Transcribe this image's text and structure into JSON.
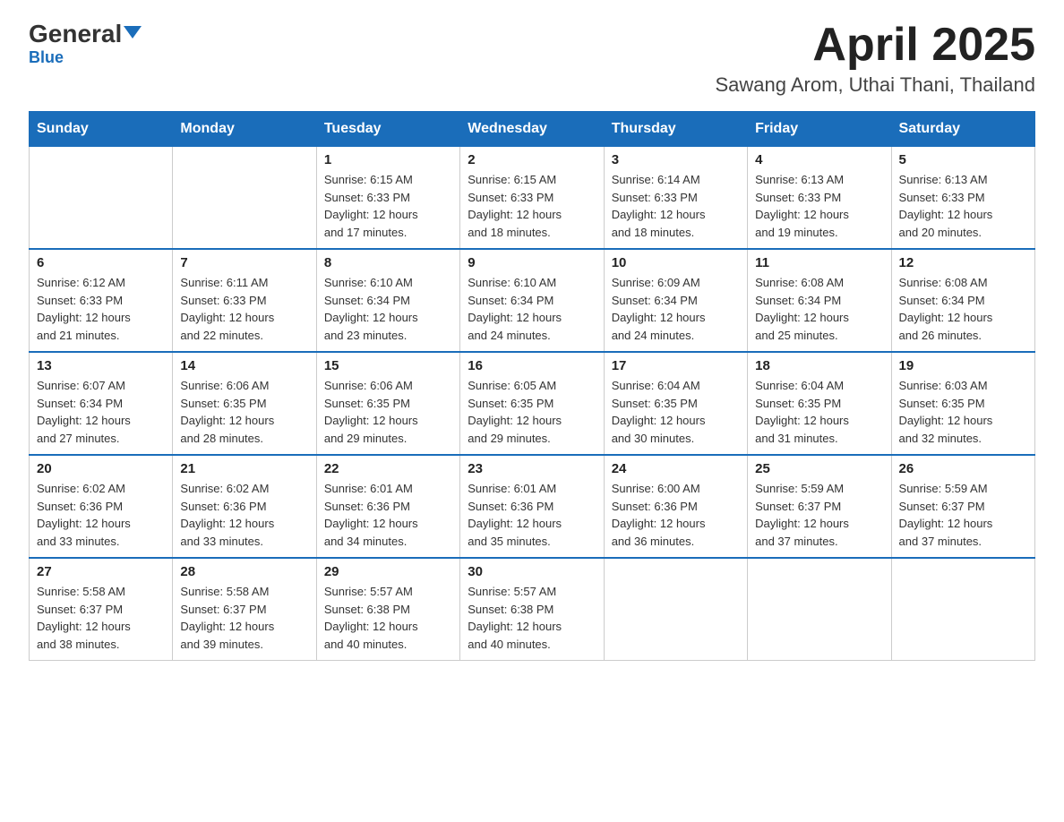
{
  "header": {
    "logo_main": "General",
    "logo_sub": "Blue",
    "month": "April 2025",
    "location": "Sawang Arom, Uthai Thani, Thailand"
  },
  "weekdays": [
    "Sunday",
    "Monday",
    "Tuesday",
    "Wednesday",
    "Thursday",
    "Friday",
    "Saturday"
  ],
  "weeks": [
    [
      {
        "day": "",
        "info": ""
      },
      {
        "day": "",
        "info": ""
      },
      {
        "day": "1",
        "info": "Sunrise: 6:15 AM\nSunset: 6:33 PM\nDaylight: 12 hours\nand 17 minutes."
      },
      {
        "day": "2",
        "info": "Sunrise: 6:15 AM\nSunset: 6:33 PM\nDaylight: 12 hours\nand 18 minutes."
      },
      {
        "day": "3",
        "info": "Sunrise: 6:14 AM\nSunset: 6:33 PM\nDaylight: 12 hours\nand 18 minutes."
      },
      {
        "day": "4",
        "info": "Sunrise: 6:13 AM\nSunset: 6:33 PM\nDaylight: 12 hours\nand 19 minutes."
      },
      {
        "day": "5",
        "info": "Sunrise: 6:13 AM\nSunset: 6:33 PM\nDaylight: 12 hours\nand 20 minutes."
      }
    ],
    [
      {
        "day": "6",
        "info": "Sunrise: 6:12 AM\nSunset: 6:33 PM\nDaylight: 12 hours\nand 21 minutes."
      },
      {
        "day": "7",
        "info": "Sunrise: 6:11 AM\nSunset: 6:33 PM\nDaylight: 12 hours\nand 22 minutes."
      },
      {
        "day": "8",
        "info": "Sunrise: 6:10 AM\nSunset: 6:34 PM\nDaylight: 12 hours\nand 23 minutes."
      },
      {
        "day": "9",
        "info": "Sunrise: 6:10 AM\nSunset: 6:34 PM\nDaylight: 12 hours\nand 24 minutes."
      },
      {
        "day": "10",
        "info": "Sunrise: 6:09 AM\nSunset: 6:34 PM\nDaylight: 12 hours\nand 24 minutes."
      },
      {
        "day": "11",
        "info": "Sunrise: 6:08 AM\nSunset: 6:34 PM\nDaylight: 12 hours\nand 25 minutes."
      },
      {
        "day": "12",
        "info": "Sunrise: 6:08 AM\nSunset: 6:34 PM\nDaylight: 12 hours\nand 26 minutes."
      }
    ],
    [
      {
        "day": "13",
        "info": "Sunrise: 6:07 AM\nSunset: 6:34 PM\nDaylight: 12 hours\nand 27 minutes."
      },
      {
        "day": "14",
        "info": "Sunrise: 6:06 AM\nSunset: 6:35 PM\nDaylight: 12 hours\nand 28 minutes."
      },
      {
        "day": "15",
        "info": "Sunrise: 6:06 AM\nSunset: 6:35 PM\nDaylight: 12 hours\nand 29 minutes."
      },
      {
        "day": "16",
        "info": "Sunrise: 6:05 AM\nSunset: 6:35 PM\nDaylight: 12 hours\nand 29 minutes."
      },
      {
        "day": "17",
        "info": "Sunrise: 6:04 AM\nSunset: 6:35 PM\nDaylight: 12 hours\nand 30 minutes."
      },
      {
        "day": "18",
        "info": "Sunrise: 6:04 AM\nSunset: 6:35 PM\nDaylight: 12 hours\nand 31 minutes."
      },
      {
        "day": "19",
        "info": "Sunrise: 6:03 AM\nSunset: 6:35 PM\nDaylight: 12 hours\nand 32 minutes."
      }
    ],
    [
      {
        "day": "20",
        "info": "Sunrise: 6:02 AM\nSunset: 6:36 PM\nDaylight: 12 hours\nand 33 minutes."
      },
      {
        "day": "21",
        "info": "Sunrise: 6:02 AM\nSunset: 6:36 PM\nDaylight: 12 hours\nand 33 minutes."
      },
      {
        "day": "22",
        "info": "Sunrise: 6:01 AM\nSunset: 6:36 PM\nDaylight: 12 hours\nand 34 minutes."
      },
      {
        "day": "23",
        "info": "Sunrise: 6:01 AM\nSunset: 6:36 PM\nDaylight: 12 hours\nand 35 minutes."
      },
      {
        "day": "24",
        "info": "Sunrise: 6:00 AM\nSunset: 6:36 PM\nDaylight: 12 hours\nand 36 minutes."
      },
      {
        "day": "25",
        "info": "Sunrise: 5:59 AM\nSunset: 6:37 PM\nDaylight: 12 hours\nand 37 minutes."
      },
      {
        "day": "26",
        "info": "Sunrise: 5:59 AM\nSunset: 6:37 PM\nDaylight: 12 hours\nand 37 minutes."
      }
    ],
    [
      {
        "day": "27",
        "info": "Sunrise: 5:58 AM\nSunset: 6:37 PM\nDaylight: 12 hours\nand 38 minutes."
      },
      {
        "day": "28",
        "info": "Sunrise: 5:58 AM\nSunset: 6:37 PM\nDaylight: 12 hours\nand 39 minutes."
      },
      {
        "day": "29",
        "info": "Sunrise: 5:57 AM\nSunset: 6:38 PM\nDaylight: 12 hours\nand 40 minutes."
      },
      {
        "day": "30",
        "info": "Sunrise: 5:57 AM\nSunset: 6:38 PM\nDaylight: 12 hours\nand 40 minutes."
      },
      {
        "day": "",
        "info": ""
      },
      {
        "day": "",
        "info": ""
      },
      {
        "day": "",
        "info": ""
      }
    ]
  ]
}
